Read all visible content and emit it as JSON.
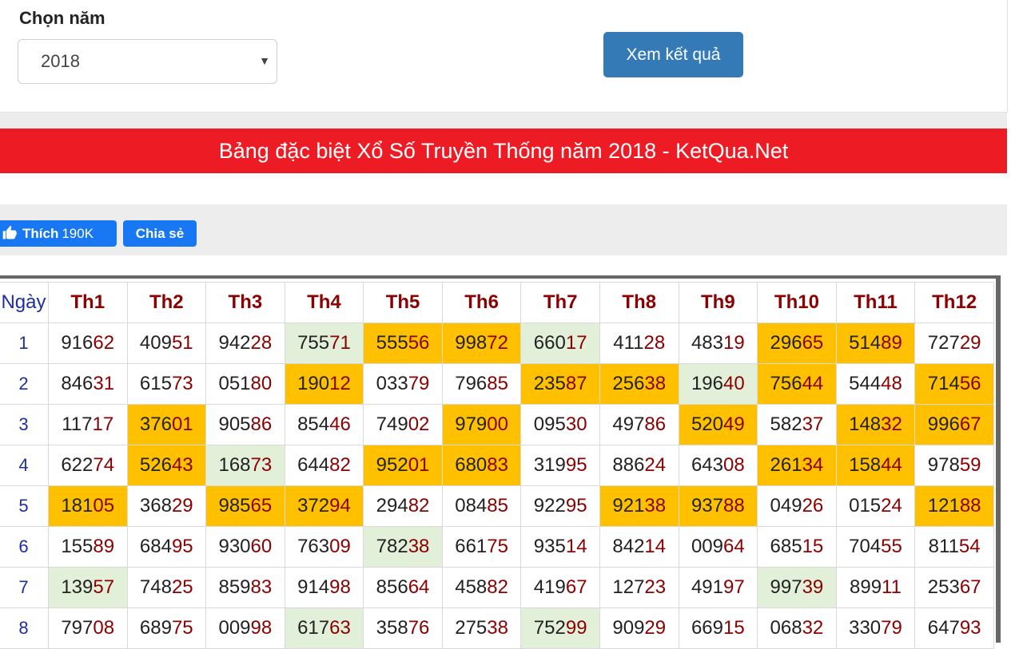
{
  "filter": {
    "year_label": "Chọn năm",
    "selected_year": "2018",
    "submit_label": "Xem kết quả"
  },
  "banner": {
    "title": "Bảng đặc biệt Xổ Số Truyền Thống năm 2018 - KetQua.Net"
  },
  "social": {
    "like_label": "Thích",
    "like_count": "190K",
    "share_label": "Chia sẻ"
  },
  "colors": {
    "banner_red": "#ed1c24",
    "button_blue": "#337ab7",
    "facebook_blue": "#1877f2",
    "highlight_orange": "#ffc000",
    "highlight_green": "#e2f0d9",
    "header_text": "#8b0000",
    "day_text": "#1d2ea0"
  },
  "table": {
    "day_header": "Ngày",
    "months": [
      "Th1",
      "Th2",
      "Th3",
      "Th4",
      "Th5",
      "Th6",
      "Th7",
      "Th8",
      "Th9",
      "Th10",
      "Th11",
      "Th12"
    ],
    "rows": [
      {
        "day": "1",
        "cells": [
          {
            "head": "916",
            "tail": "62",
            "hl": ""
          },
          {
            "head": "409",
            "tail": "51",
            "hl": ""
          },
          {
            "head": "942",
            "tail": "28",
            "hl": ""
          },
          {
            "head": "755",
            "tail": "71",
            "hl": "green"
          },
          {
            "head": "555",
            "tail": "56",
            "hl": "orange"
          },
          {
            "head": "998",
            "tail": "72",
            "hl": "orange"
          },
          {
            "head": "660",
            "tail": "17",
            "hl": "green"
          },
          {
            "head": "411",
            "tail": "28",
            "hl": ""
          },
          {
            "head": "483",
            "tail": "19",
            "hl": ""
          },
          {
            "head": "296",
            "tail": "65",
            "hl": "orange"
          },
          {
            "head": "514",
            "tail": "89",
            "hl": "orange"
          },
          {
            "head": "727",
            "tail": "29",
            "hl": ""
          }
        ]
      },
      {
        "day": "2",
        "cells": [
          {
            "head": "846",
            "tail": "31",
            "hl": ""
          },
          {
            "head": "615",
            "tail": "73",
            "hl": ""
          },
          {
            "head": "051",
            "tail": "80",
            "hl": ""
          },
          {
            "head": "190",
            "tail": "12",
            "hl": "orange"
          },
          {
            "head": "033",
            "tail": "79",
            "hl": ""
          },
          {
            "head": "796",
            "tail": "85",
            "hl": ""
          },
          {
            "head": "235",
            "tail": "87",
            "hl": "orange"
          },
          {
            "head": "256",
            "tail": "38",
            "hl": "orange"
          },
          {
            "head": "196",
            "tail": "40",
            "hl": "green"
          },
          {
            "head": "756",
            "tail": "44",
            "hl": "orange"
          },
          {
            "head": "544",
            "tail": "48",
            "hl": ""
          },
          {
            "head": "714",
            "tail": "56",
            "hl": "orange"
          }
        ]
      },
      {
        "day": "3",
        "cells": [
          {
            "head": "117",
            "tail": "17",
            "hl": ""
          },
          {
            "head": "376",
            "tail": "01",
            "hl": "orange"
          },
          {
            "head": "905",
            "tail": "86",
            "hl": ""
          },
          {
            "head": "854",
            "tail": "46",
            "hl": ""
          },
          {
            "head": "749",
            "tail": "02",
            "hl": ""
          },
          {
            "head": "979",
            "tail": "00",
            "hl": "orange"
          },
          {
            "head": "095",
            "tail": "30",
            "hl": ""
          },
          {
            "head": "497",
            "tail": "86",
            "hl": ""
          },
          {
            "head": "520",
            "tail": "49",
            "hl": "orange"
          },
          {
            "head": "582",
            "tail": "37",
            "hl": ""
          },
          {
            "head": "148",
            "tail": "32",
            "hl": "orange"
          },
          {
            "head": "996",
            "tail": "67",
            "hl": "orange"
          }
        ]
      },
      {
        "day": "4",
        "cells": [
          {
            "head": "622",
            "tail": "74",
            "hl": ""
          },
          {
            "head": "526",
            "tail": "43",
            "hl": "orange"
          },
          {
            "head": "168",
            "tail": "73",
            "hl": "green"
          },
          {
            "head": "644",
            "tail": "82",
            "hl": ""
          },
          {
            "head": "952",
            "tail": "01",
            "hl": "orange"
          },
          {
            "head": "680",
            "tail": "83",
            "hl": "orange"
          },
          {
            "head": "319",
            "tail": "95",
            "hl": ""
          },
          {
            "head": "886",
            "tail": "24",
            "hl": ""
          },
          {
            "head": "643",
            "tail": "08",
            "hl": ""
          },
          {
            "head": "261",
            "tail": "34",
            "hl": "orange"
          },
          {
            "head": "158",
            "tail": "44",
            "hl": "orange"
          },
          {
            "head": "978",
            "tail": "59",
            "hl": ""
          }
        ]
      },
      {
        "day": "5",
        "cells": [
          {
            "head": "181",
            "tail": "05",
            "hl": "orange"
          },
          {
            "head": "368",
            "tail": "29",
            "hl": ""
          },
          {
            "head": "985",
            "tail": "65",
            "hl": "orange"
          },
          {
            "head": "372",
            "tail": "94",
            "hl": "orange"
          },
          {
            "head": "294",
            "tail": "82",
            "hl": ""
          },
          {
            "head": "084",
            "tail": "85",
            "hl": ""
          },
          {
            "head": "922",
            "tail": "95",
            "hl": ""
          },
          {
            "head": "921",
            "tail": "38",
            "hl": "orange"
          },
          {
            "head": "937",
            "tail": "88",
            "hl": "orange"
          },
          {
            "head": "049",
            "tail": "26",
            "hl": ""
          },
          {
            "head": "015",
            "tail": "24",
            "hl": ""
          },
          {
            "head": "121",
            "tail": "88",
            "hl": "orange"
          }
        ]
      },
      {
        "day": "6",
        "cells": [
          {
            "head": "155",
            "tail": "89",
            "hl": ""
          },
          {
            "head": "684",
            "tail": "95",
            "hl": ""
          },
          {
            "head": "930",
            "tail": "60",
            "hl": ""
          },
          {
            "head": "763",
            "tail": "09",
            "hl": ""
          },
          {
            "head": "782",
            "tail": "38",
            "hl": "green"
          },
          {
            "head": "661",
            "tail": "75",
            "hl": ""
          },
          {
            "head": "935",
            "tail": "14",
            "hl": ""
          },
          {
            "head": "842",
            "tail": "14",
            "hl": ""
          },
          {
            "head": "009",
            "tail": "64",
            "hl": ""
          },
          {
            "head": "685",
            "tail": "15",
            "hl": ""
          },
          {
            "head": "704",
            "tail": "55",
            "hl": ""
          },
          {
            "head": "811",
            "tail": "54",
            "hl": ""
          }
        ]
      },
      {
        "day": "7",
        "cells": [
          {
            "head": "139",
            "tail": "57",
            "hl": "green"
          },
          {
            "head": "748",
            "tail": "25",
            "hl": ""
          },
          {
            "head": "859",
            "tail": "83",
            "hl": ""
          },
          {
            "head": "914",
            "tail": "98",
            "hl": ""
          },
          {
            "head": "856",
            "tail": "64",
            "hl": ""
          },
          {
            "head": "458",
            "tail": "82",
            "hl": ""
          },
          {
            "head": "419",
            "tail": "67",
            "hl": ""
          },
          {
            "head": "127",
            "tail": "23",
            "hl": ""
          },
          {
            "head": "491",
            "tail": "97",
            "hl": ""
          },
          {
            "head": "997",
            "tail": "39",
            "hl": "green"
          },
          {
            "head": "899",
            "tail": "11",
            "hl": ""
          },
          {
            "head": "253",
            "tail": "67",
            "hl": ""
          }
        ]
      },
      {
        "day": "8",
        "cells": [
          {
            "head": "797",
            "tail": "08",
            "hl": ""
          },
          {
            "head": "689",
            "tail": "75",
            "hl": ""
          },
          {
            "head": "009",
            "tail": "98",
            "hl": ""
          },
          {
            "head": "617",
            "tail": "63",
            "hl": "green"
          },
          {
            "head": "358",
            "tail": "76",
            "hl": ""
          },
          {
            "head": "275",
            "tail": "38",
            "hl": ""
          },
          {
            "head": "752",
            "tail": "99",
            "hl": "green"
          },
          {
            "head": "909",
            "tail": "29",
            "hl": ""
          },
          {
            "head": "669",
            "tail": "15",
            "hl": ""
          },
          {
            "head": "068",
            "tail": "32",
            "hl": ""
          },
          {
            "head": "330",
            "tail": "79",
            "hl": ""
          },
          {
            "head": "647",
            "tail": "93",
            "hl": ""
          }
        ]
      }
    ]
  }
}
